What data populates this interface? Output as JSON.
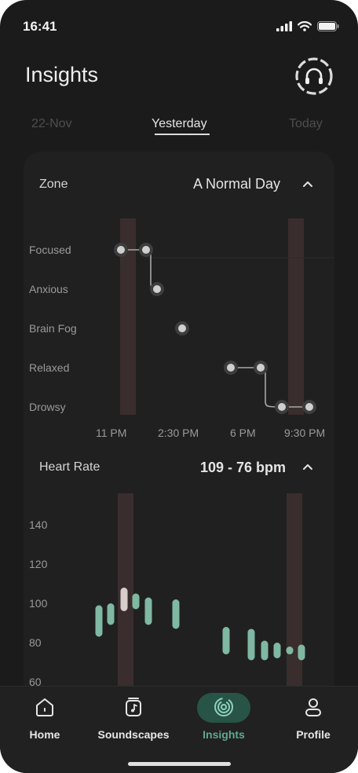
{
  "status": {
    "time": "16:41"
  },
  "header": {
    "title": "Insights",
    "headphones_icon": "headphones-icon"
  },
  "date_tabs": [
    {
      "label": "22-Nov",
      "active": false
    },
    {
      "label": "Yesterday",
      "active": true
    },
    {
      "label": "Today",
      "active": false
    }
  ],
  "zone": {
    "label": "Zone",
    "value": "A Normal Day",
    "y_levels": [
      "Focused",
      "Anxious",
      "Brain Fog",
      "Relaxed",
      "Drowsy"
    ],
    "x_ticks": [
      "11 PM",
      "2:30 PM",
      "6 PM",
      "9:30 PM"
    ]
  },
  "heart_rate": {
    "label": "Heart Rate",
    "value": "109 - 76 bpm",
    "y_ticks": [
      "140",
      "120",
      "100",
      "80",
      "60"
    ]
  },
  "chart_data": [
    {
      "type": "scatter",
      "title": "Zone",
      "ylabel": "",
      "y_categories": [
        "Focused",
        "Anxious",
        "Brain Fog",
        "Relaxed",
        "Drowsy"
      ],
      "x_ticks": [
        "11 PM",
        "2:30 PM",
        "6 PM",
        "9:30 PM"
      ],
      "points": [
        {
          "x": 0.31,
          "level": "Focused"
        },
        {
          "x": 0.71,
          "level": "Focused"
        },
        {
          "x": 0.9,
          "level": "Anxious"
        },
        {
          "x": 1.29,
          "level": "Brain Fog"
        },
        {
          "x": 2.07,
          "level": "Relaxed"
        },
        {
          "x": 2.56,
          "level": "Relaxed"
        },
        {
          "x": 2.9,
          "level": "Drowsy"
        },
        {
          "x": 3.39,
          "level": "Drowsy"
        }
      ]
    },
    {
      "type": "bar",
      "title": "Heart Rate",
      "ylim": [
        60,
        140
      ],
      "yticks": [
        140,
        120,
        100,
        80,
        60
      ],
      "bars": [
        {
          "x": 0.0,
          "low": 83,
          "high": 99
        },
        {
          "x": 0.45,
          "low": 89,
          "high": 100
        },
        {
          "x": 0.9,
          "low": 96,
          "high": 108,
          "highlight": true
        },
        {
          "x": 1.28,
          "low": 97,
          "high": 105
        },
        {
          "x": 1.7,
          "low": 89,
          "high": 103
        },
        {
          "x": 2.65,
          "low": 87,
          "high": 102
        },
        {
          "x": 4.3,
          "low": 74,
          "high": 88
        },
        {
          "x": 5.2,
          "low": 71,
          "high": 87
        },
        {
          "x": 5.6,
          "low": 71,
          "high": 81
        },
        {
          "x": 5.95,
          "low": 72,
          "high": 80
        },
        {
          "x": 6.35,
          "low": 74,
          "high": 78
        },
        {
          "x": 6.65,
          "low": 71,
          "high": 79
        }
      ]
    }
  ],
  "nav": [
    {
      "label": "Home",
      "icon": "home-icon",
      "active": false
    },
    {
      "label": "Soundscapes",
      "icon": "music-box-icon",
      "active": false
    },
    {
      "label": "Insights",
      "icon": "insights-rings-icon",
      "active": true
    },
    {
      "label": "Profile",
      "icon": "profile-icon",
      "active": false
    }
  ],
  "colors": {
    "background": "#1b1b1b",
    "card": "#202020",
    "accent": "#5fa892",
    "hr_bar": "#7fb8a3",
    "highlight_band": "#3a2d2d"
  }
}
